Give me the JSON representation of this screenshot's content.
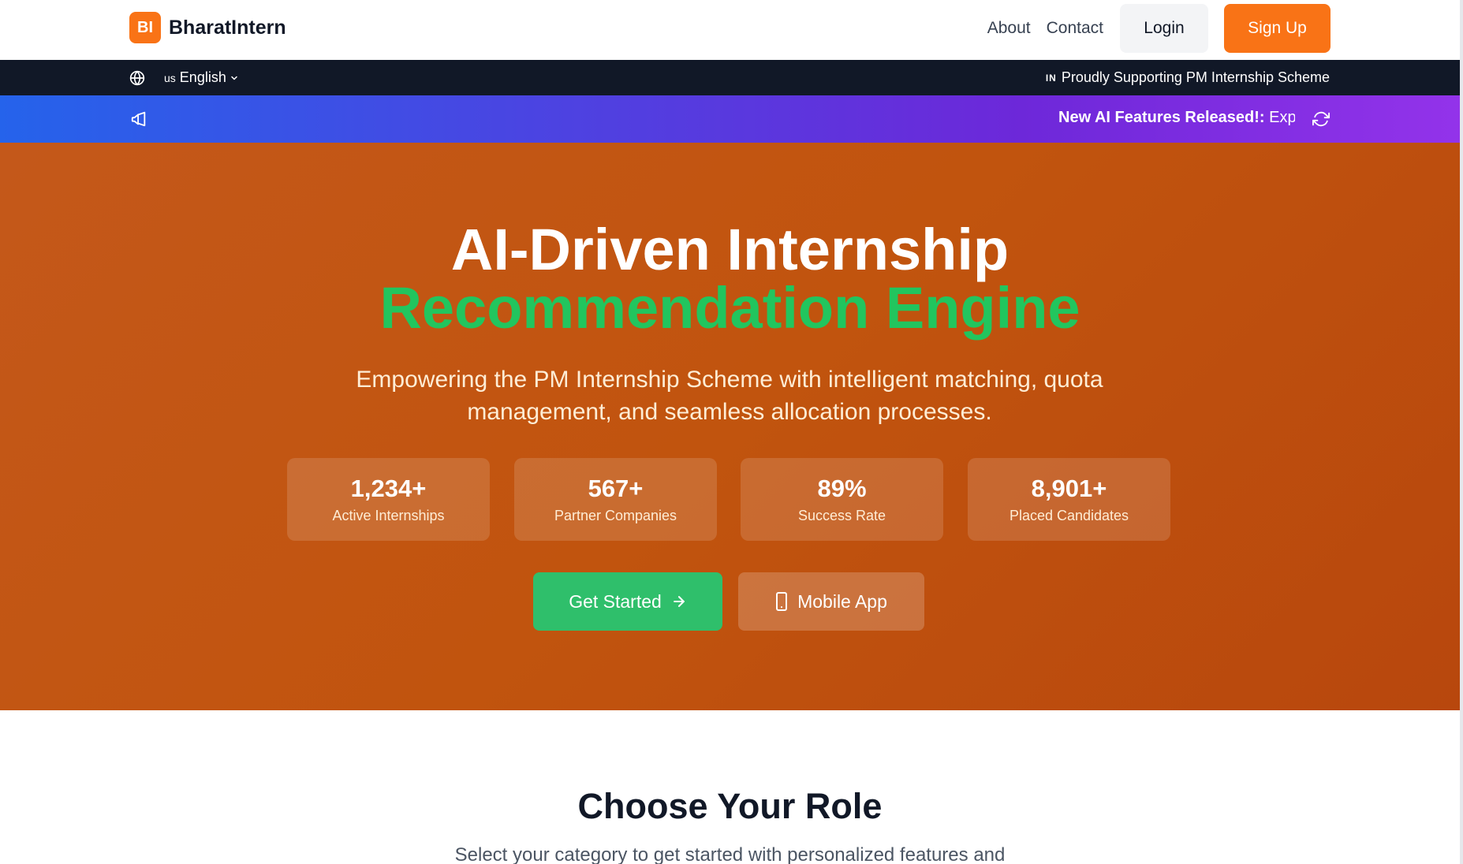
{
  "brand": {
    "logo_text": "BI",
    "name": "BharatIntern",
    "accent": "#f97316"
  },
  "nav": {
    "about": "About",
    "contact": "Contact",
    "login": "Login",
    "signup": "Sign Up"
  },
  "topbar": {
    "language_code": "us",
    "language": "English",
    "support_flag": "IN",
    "support_text": "Proudly Supporting PM Internship Scheme"
  },
  "announcement": {
    "title": "New AI Features Released!:",
    "text": "Exp"
  },
  "hero": {
    "title_line1": "AI-Driven Internship",
    "title_line2": "Recommendation Engine",
    "subtitle": "Empowering the PM Internship Scheme with intelligent matching, quota management, and seamless allocation processes.",
    "stats": [
      {
        "value": "1,234+",
        "label": "Active Internships"
      },
      {
        "value": "567+",
        "label": "Partner Companies"
      },
      {
        "value": "89%",
        "label": "Success Rate"
      },
      {
        "value": "8,901+",
        "label": "Placed Candidates"
      }
    ],
    "cta_primary": "Get Started",
    "cta_secondary": "Mobile App",
    "accent_green": "#22c55e"
  },
  "roles": {
    "title": "Choose Your Role",
    "subtitle": "Select your category to get started with personalized features and"
  }
}
